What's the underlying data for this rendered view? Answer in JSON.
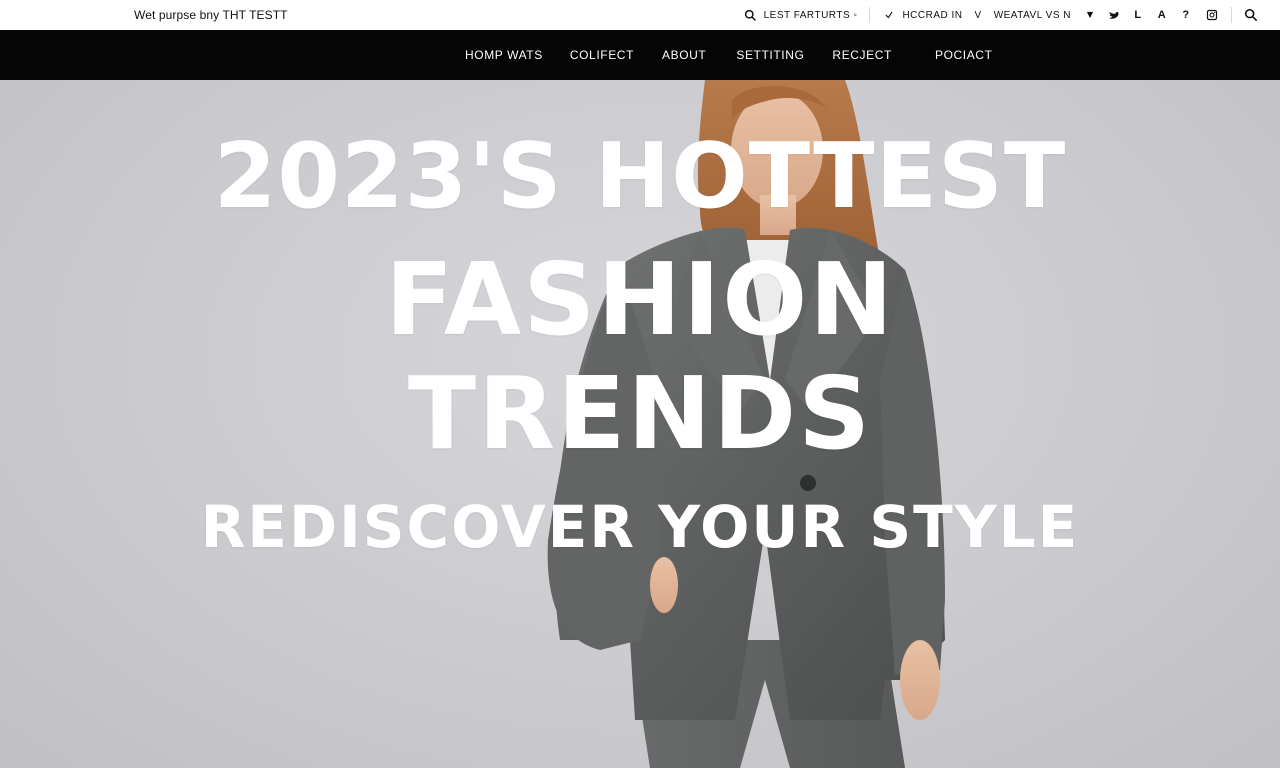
{
  "site": {
    "brand": "Wet purpse bny THT TESTT"
  },
  "utility_bar": {
    "search_label": "LEST FARTURTS ◦",
    "account_label": "HCCRAD IN",
    "currency_label": "V",
    "location_label": "WEATAVL VS N",
    "social": {
      "icons": [
        "arrow-icon",
        "twitter-icon",
        "letter-l-icon",
        "letter-a-icon",
        "question-icon"
      ],
      "labels": [
        "⏷",
        "🐦",
        "L",
        "A",
        "?"
      ]
    }
  },
  "nav": {
    "items": [
      "HOMP WATS",
      "COLIFECT",
      "ABOUT",
      "SETTITING",
      "RECJECT",
      "POCIACT"
    ]
  },
  "hero": {
    "line1": "2023'S HOTTEST",
    "line2": "FASHION",
    "line3": "TRENDS",
    "line4": "REDISCOVER YOUR STYLE"
  },
  "colors": {
    "nav_background": "#050505",
    "topbar_background": "#ffffff",
    "hero_background": "#cfcfd3",
    "headline_text": "#ffffff"
  }
}
